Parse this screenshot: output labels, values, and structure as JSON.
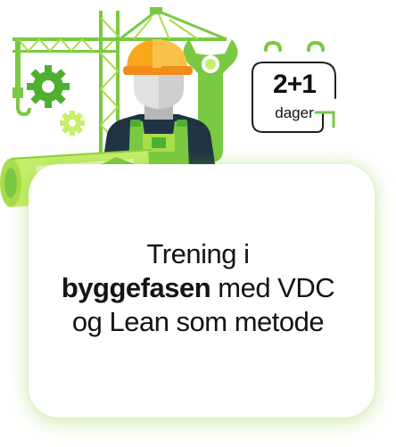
{
  "badge": {
    "number": "2+1",
    "unit": "dager"
  },
  "card": {
    "line1": "Trening i",
    "line2_bold": "byggefasen",
    "line2_rest": " med VDC",
    "line3": "og Lean som metode"
  },
  "colors": {
    "accent_green": "#7ac943",
    "light_green": "#c6ef6b",
    "dark_navy": "#1f3345",
    "helmet_yellow": "#f7a81b"
  },
  "illustration": {
    "icons": [
      "crane-icon",
      "gear-icon",
      "wrench-icon",
      "hard-hat-icon",
      "worker-icon",
      "blueprint-roll-icon",
      "set-square-icon",
      "pencil-icon",
      "calendar-icon"
    ]
  }
}
